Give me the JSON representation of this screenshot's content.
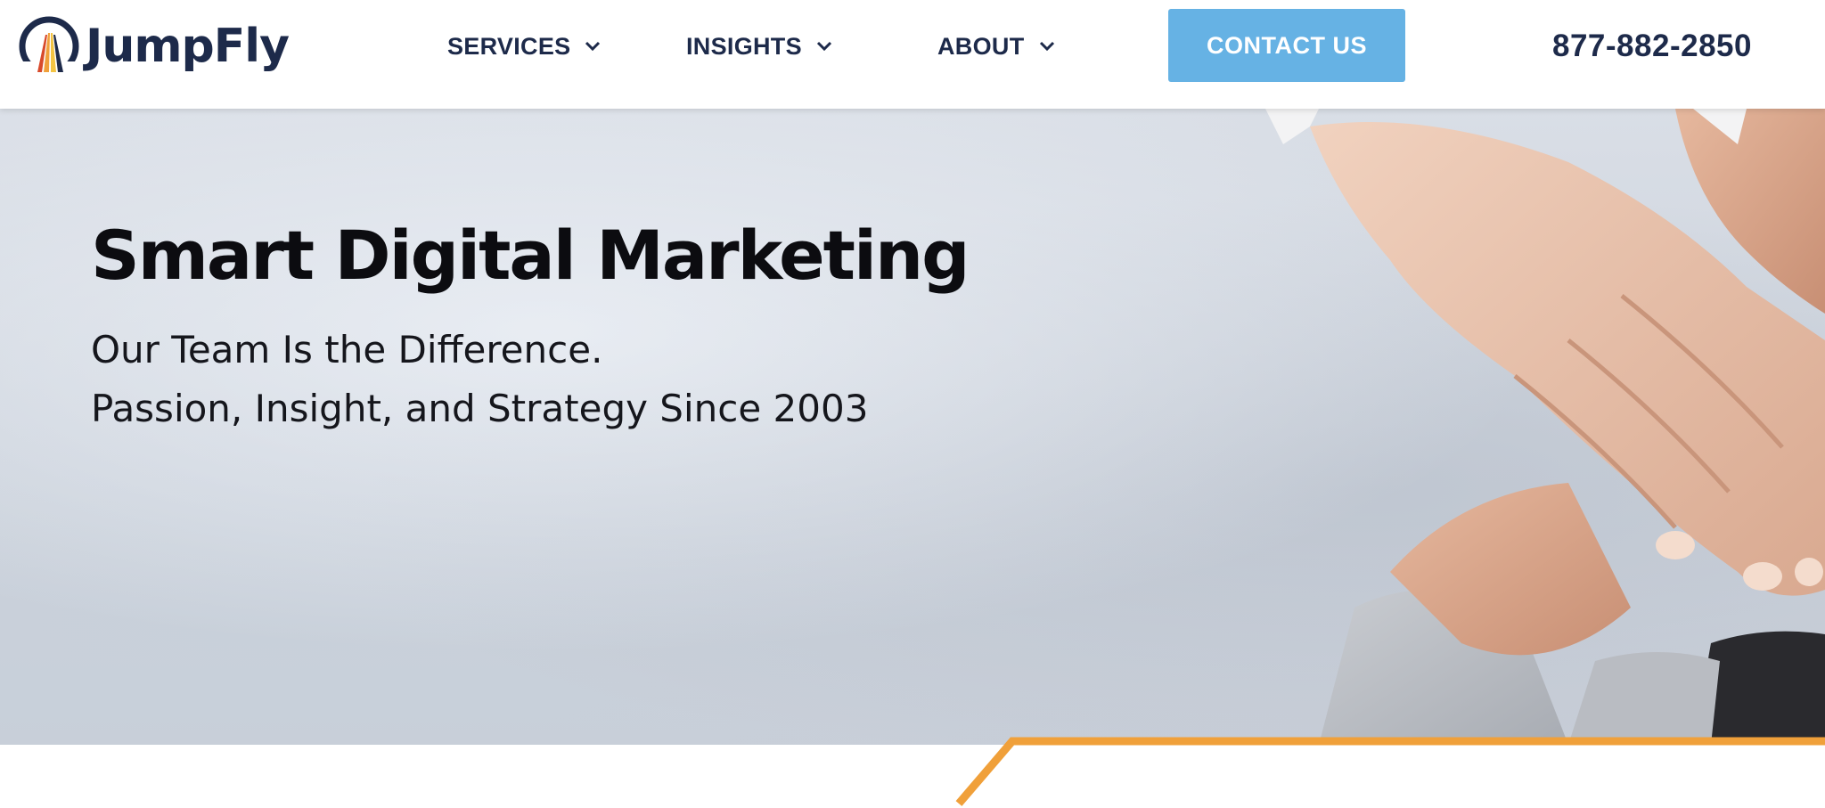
{
  "brand": {
    "name": "JumpFly",
    "logo_icon": "jumpfly-arch-logo"
  },
  "nav": {
    "items": [
      {
        "label": "SERVICES",
        "icon": "chevron-down-icon"
      },
      {
        "label": "INSIGHTS",
        "icon": "chevron-down-icon"
      },
      {
        "label": "ABOUT",
        "icon": "chevron-down-icon"
      }
    ],
    "cta_label": "CONTACT US",
    "phone": "877-882-2850"
  },
  "hero": {
    "title": "Smart Digital Marketing",
    "subtitle_line1": "Our Team Is the Difference.",
    "subtitle_line2": "Passion, Insight, and Strategy Since 2003",
    "image": "team-hands-stacked-photo"
  },
  "colors": {
    "navy": "#1d2a4a",
    "cta_blue": "#66b2e4",
    "accent_orange": "#f0a03a",
    "hero_gray": "#d3d9e1"
  }
}
